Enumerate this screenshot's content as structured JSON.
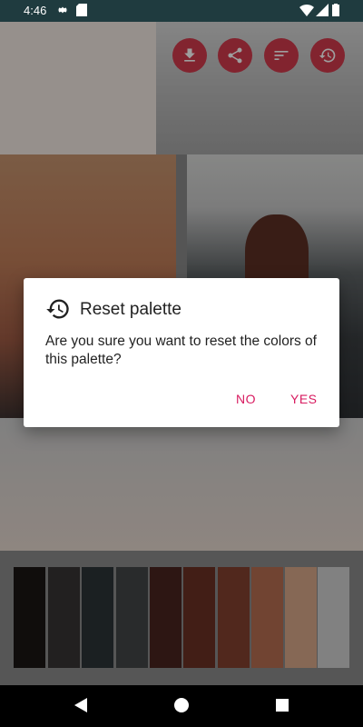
{
  "status_bar": {
    "time": "4:46"
  },
  "dialog": {
    "title": "Reset palette",
    "message": "Are you sure you want to reset the colors of this palette?",
    "no_label": "NO",
    "yes_label": "YES"
  },
  "actions": [
    {
      "name": "download-button",
      "icon": "download-icon"
    },
    {
      "name": "share-button",
      "icon": "share-icon"
    },
    {
      "name": "sort-button",
      "icon": "sort-icon"
    },
    {
      "name": "history-button",
      "icon": "history-icon"
    }
  ],
  "palette_colors": [
    "#1a1514",
    "#373434",
    "#2c3437",
    "#434647",
    "#4a2420",
    "#6b3125",
    "#84412f",
    "#b66e52",
    "#d8a88a",
    "#d0d1d0"
  ],
  "colors": {
    "accent": "#d81b60",
    "fab": "#d23a4c",
    "status_bar": "#1f3b3f"
  }
}
